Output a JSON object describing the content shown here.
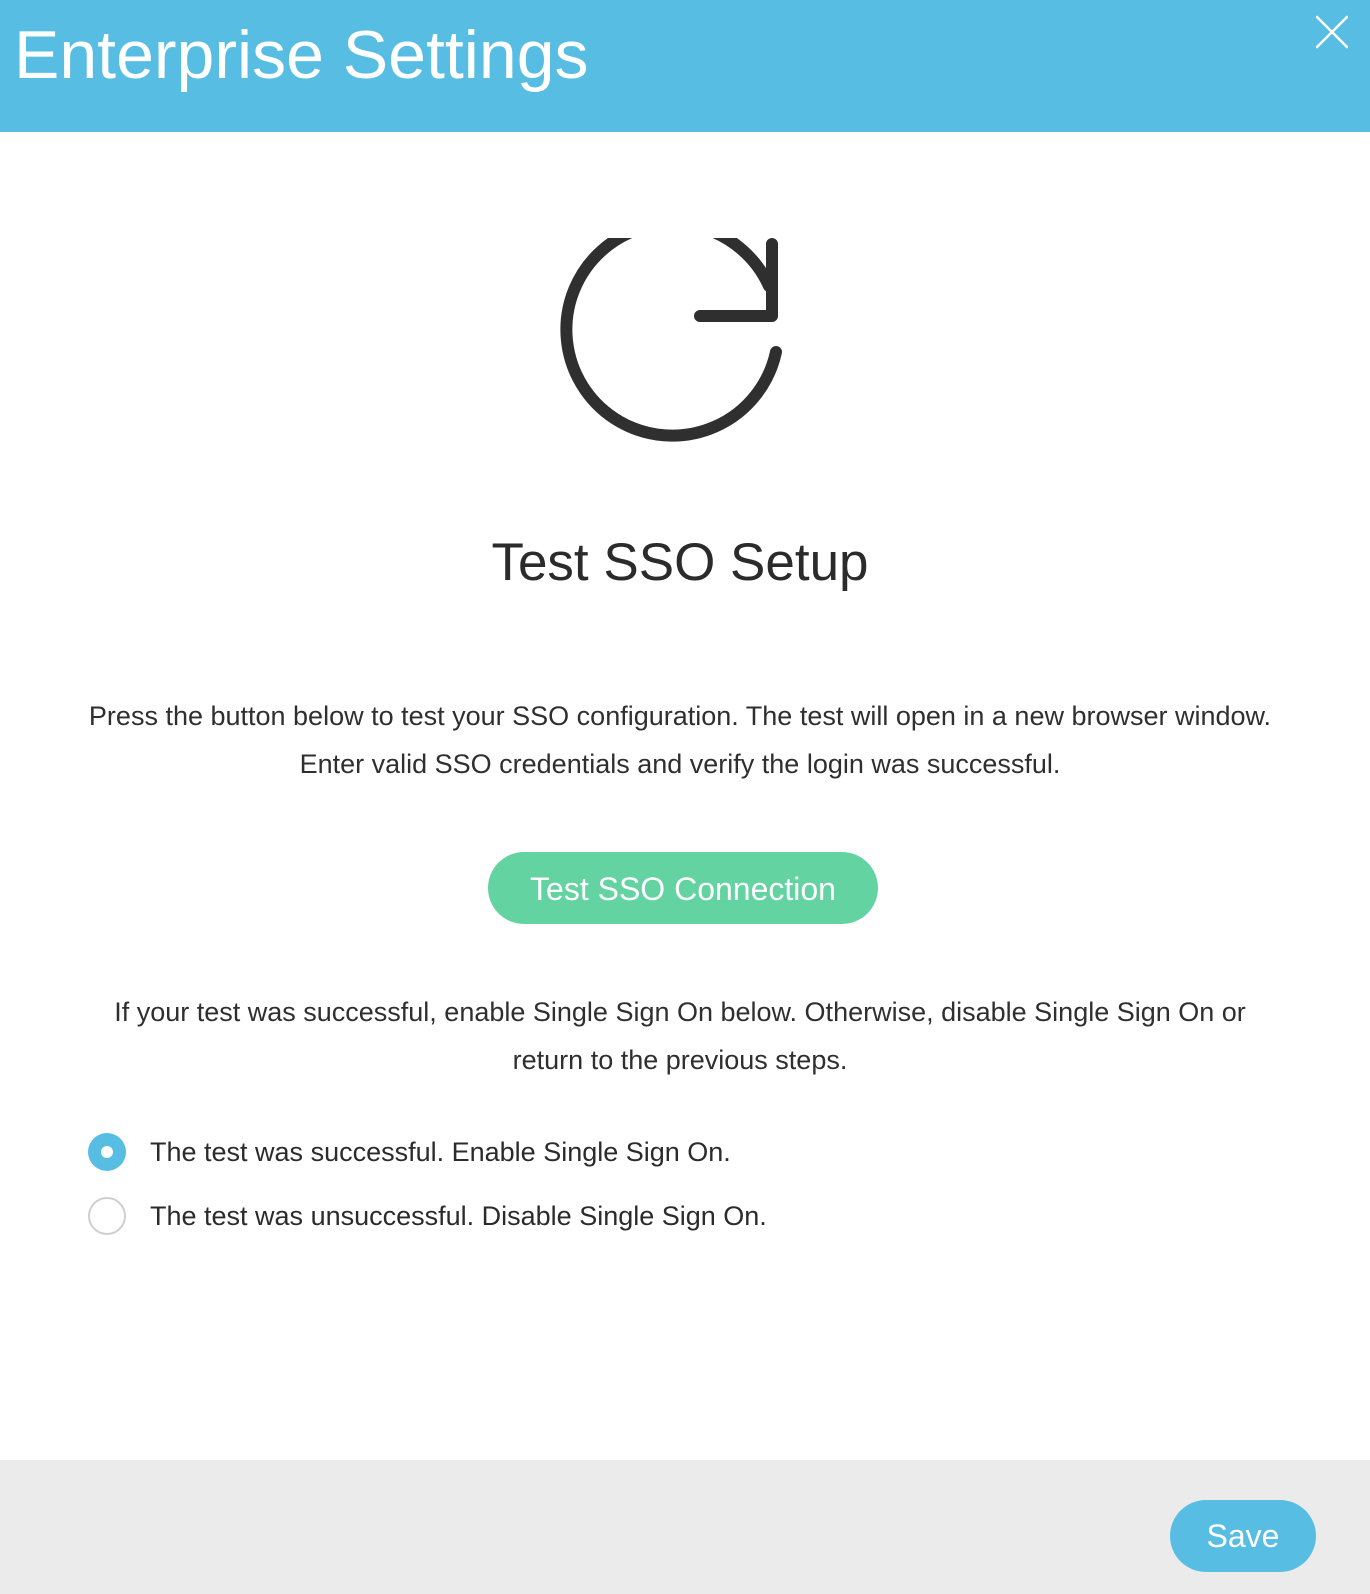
{
  "header": {
    "title": "Enterprise Settings",
    "close_icon": "close-icon",
    "background_color": "#58bde2"
  },
  "main": {
    "icon": "refresh-icon",
    "title": "Test SSO Setup",
    "instructions": "Press the button below to test your SSO configuration. The test will open in a new browser window. Enter valid SSO credentials and verify the login was successful.",
    "test_button_label": "Test SSO Connection",
    "test_button_color": "#63d3a1",
    "result_instructions": "If your test was successful, enable Single Sign On below. Otherwise, disable Single Sign On or return to the previous steps.",
    "options": [
      {
        "label": "The test was successful. Enable Single Sign On.",
        "selected": true
      },
      {
        "label": "The test was unsuccessful. Disable Single Sign On.",
        "selected": false
      }
    ]
  },
  "footer": {
    "save_label": "Save",
    "background_color": "#ebebeb"
  }
}
